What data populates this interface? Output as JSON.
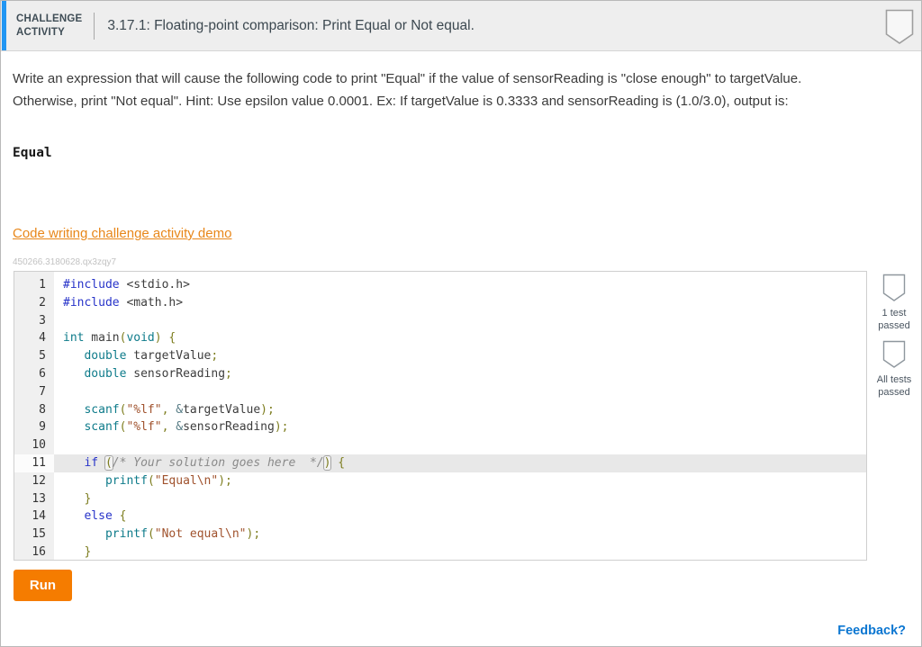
{
  "header": {
    "badge_line1": "CHALLENGE",
    "badge_line2": "ACTIVITY",
    "title": "3.17.1: Floating-point comparison: Print Equal or Not equal."
  },
  "instructions": {
    "paragraph": "Write an expression that will cause the following code to print \"Equal\" if the value of sensorReading is \"close enough\" to targetValue. Otherwise, print \"Not equal\". Hint: Use epsilon value 0.0001. Ex: If targetValue is 0.3333 and sensorReading is (1.0/3.0), output is:",
    "sample_output": "Equal"
  },
  "demo_link": {
    "label": "Code writing challenge activity demo"
  },
  "activity_id": "450266.3180628.qx3zqy7",
  "editor": {
    "language": "C",
    "active_line": 11,
    "lines": [
      [
        [
          "kw",
          "#include"
        ],
        [
          "tx",
          " <stdio.h>"
        ]
      ],
      [
        [
          "kw",
          "#include"
        ],
        [
          "tx",
          " <math.h>"
        ]
      ],
      [],
      [
        [
          "ty",
          "int"
        ],
        [
          "tx",
          " main"
        ],
        [
          "pu",
          "("
        ],
        [
          "ty",
          "void"
        ],
        [
          "pu",
          ")"
        ],
        [
          "tx",
          " "
        ],
        [
          "pu",
          "{"
        ]
      ],
      [
        [
          "tx",
          "   "
        ],
        [
          "ty",
          "double"
        ],
        [
          "tx",
          " targetValue"
        ],
        [
          "pu",
          ";"
        ]
      ],
      [
        [
          "tx",
          "   "
        ],
        [
          "ty",
          "double"
        ],
        [
          "tx",
          " sensorReading"
        ],
        [
          "pu",
          ";"
        ]
      ],
      [],
      [
        [
          "tx",
          "   "
        ],
        [
          "fn",
          "scanf"
        ],
        [
          "pu",
          "("
        ],
        [
          "st",
          "\"%lf\""
        ],
        [
          "pu",
          ","
        ],
        [
          "tx",
          " "
        ],
        [
          "am",
          "&"
        ],
        [
          "tx",
          "targetValue"
        ],
        [
          "pu",
          ");"
        ]
      ],
      [
        [
          "tx",
          "   "
        ],
        [
          "fn",
          "scanf"
        ],
        [
          "pu",
          "("
        ],
        [
          "st",
          "\"%lf\""
        ],
        [
          "pu",
          ","
        ],
        [
          "tx",
          " "
        ],
        [
          "am",
          "&"
        ],
        [
          "tx",
          "sensorReading"
        ],
        [
          "pu",
          ");"
        ]
      ],
      [],
      [
        [
          "tx",
          "   "
        ],
        [
          "kw",
          "if"
        ],
        [
          "tx",
          " "
        ],
        [
          "mt",
          "("
        ],
        [
          "cm",
          "/* Your solution goes here  */"
        ],
        [
          "mt",
          ")"
        ],
        [
          "tx",
          " "
        ],
        [
          "pu",
          "{"
        ]
      ],
      [
        [
          "tx",
          "      "
        ],
        [
          "fn",
          "printf"
        ],
        [
          "pu",
          "("
        ],
        [
          "st",
          "\"Equal\\n\""
        ],
        [
          "pu",
          ");"
        ]
      ],
      [
        [
          "tx",
          "   "
        ],
        [
          "pu",
          "}"
        ]
      ],
      [
        [
          "tx",
          "   "
        ],
        [
          "kw",
          "else"
        ],
        [
          "tx",
          " "
        ],
        [
          "pu",
          "{"
        ]
      ],
      [
        [
          "tx",
          "      "
        ],
        [
          "fn",
          "printf"
        ],
        [
          "pu",
          "("
        ],
        [
          "st",
          "\"Not equal\\n\""
        ],
        [
          "pu",
          ");"
        ]
      ],
      [
        [
          "tx",
          "   "
        ],
        [
          "pu",
          "}"
        ]
      ]
    ]
  },
  "tests": [
    {
      "label": "1 test passed"
    },
    {
      "label": "All tests passed"
    }
  ],
  "run_button": {
    "label": "Run"
  },
  "feedback_link": {
    "label": "Feedback?"
  },
  "colors": {
    "accent_blue": "#2196f3",
    "run_orange": "#f57c00",
    "link_orange": "#e8871a",
    "feedback_blue": "#0b76d1",
    "header_bg": "#eeeeee",
    "active_line_bg": "#e8e8e8"
  }
}
